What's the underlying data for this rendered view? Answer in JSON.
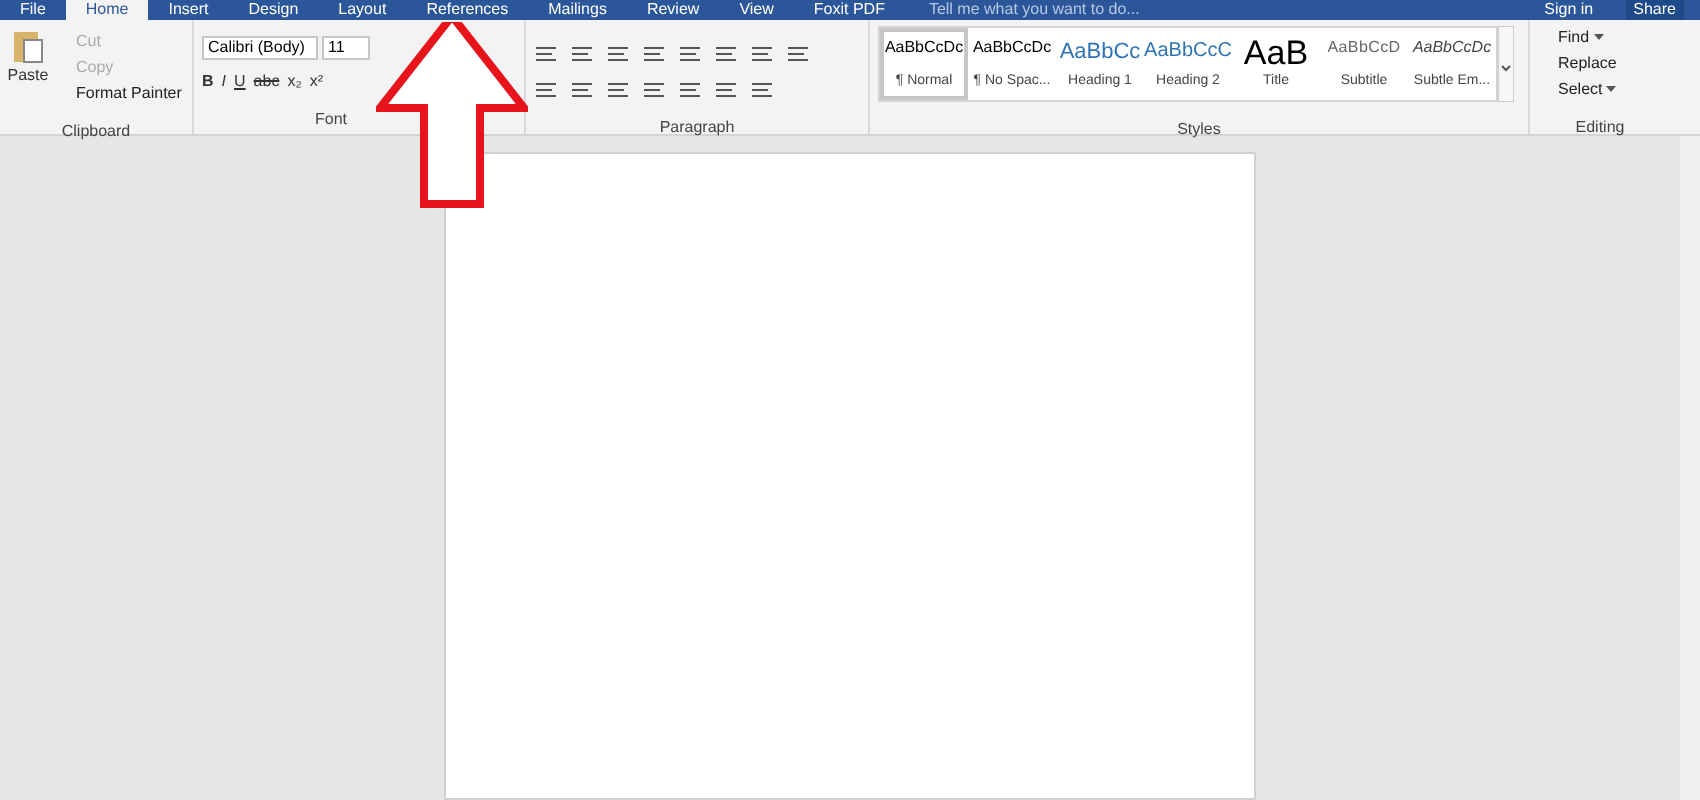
{
  "tabs": [
    {
      "label": "File",
      "selected": false
    },
    {
      "label": "Home",
      "selected": true
    },
    {
      "label": "Insert",
      "selected": false
    },
    {
      "label": "Design",
      "selected": false
    },
    {
      "label": "Layout",
      "selected": false
    },
    {
      "label": "References",
      "selected": false
    },
    {
      "label": "Mailings",
      "selected": false
    },
    {
      "label": "Review",
      "selected": false
    },
    {
      "label": "View",
      "selected": false
    },
    {
      "label": "Foxit PDF",
      "selected": false
    }
  ],
  "tell_me": {
    "placeholder": "Tell me what you want to do..."
  },
  "sign_in": "Sign in",
  "share": "Share",
  "clipboard": {
    "label": "Clipboard",
    "paste": "Paste",
    "items": [
      {
        "label": "Cut",
        "disabled": true
      },
      {
        "label": "Copy",
        "disabled": true
      },
      {
        "label": "Format Painter",
        "disabled": false
      }
    ]
  },
  "font": {
    "label": "Font",
    "name": "Calibri (Body)",
    "size": "11",
    "format_buttons": [
      {
        "label": "B",
        "kind": "bold"
      },
      {
        "label": "I",
        "kind": "italic"
      },
      {
        "label": "U",
        "kind": "underline"
      },
      {
        "label": "abc",
        "kind": "strike"
      },
      {
        "label": "x₂",
        "kind": "plain"
      },
      {
        "label": "x²",
        "kind": "plain"
      }
    ]
  },
  "paragraph": {
    "label": "Paragraph"
  },
  "styles": {
    "label": "Styles",
    "items": [
      {
        "sample": "AaBbCcDc",
        "name": "¶ Normal",
        "kind": "normal",
        "selected": true
      },
      {
        "sample": "AaBbCcDc",
        "name": "¶ No Spac...",
        "kind": "normal",
        "selected": false
      },
      {
        "sample": "AaBbCc",
        "name": "Heading 1",
        "kind": "heading1",
        "selected": false
      },
      {
        "sample": "AaBbCcC",
        "name": "Heading 2",
        "kind": "heading2",
        "selected": false
      },
      {
        "sample": "AaB",
        "name": "Title",
        "kind": "title",
        "selected": false
      },
      {
        "sample": "AaBbCcD",
        "name": "Subtitle",
        "kind": "subtitle",
        "selected": false
      },
      {
        "sample": "AaBbCcDc",
        "name": "Subtle Em...",
        "kind": "emphasis",
        "selected": false
      }
    ]
  },
  "editing": {
    "label": "Editing",
    "items": [
      {
        "label": "Find",
        "dropdown": true
      },
      {
        "label": "Replace",
        "dropdown": false
      },
      {
        "label": "Select",
        "dropdown": true
      }
    ]
  }
}
